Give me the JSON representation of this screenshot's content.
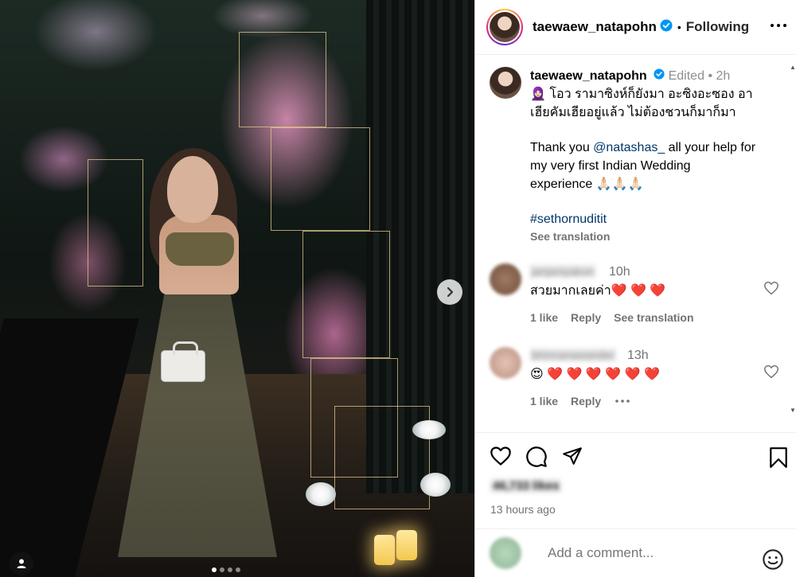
{
  "post": {
    "username": "taewaew_natapohn",
    "following_label": "Following",
    "separator": "•",
    "caption": {
      "edited_label": "Edited",
      "dot": "•",
      "time": "2h",
      "thai_line_1": "🧕🏻 โอว รามาซิงห์ก็ยังมา อะซิงอะซอง อา",
      "thai_line_2": "เฮียคัมเฮียอยู่แล้ว ไม่ต้องชวนก็มาก็มา",
      "english_1": "Thank you ",
      "mention": "@natashas_",
      "english_2": " all your help for",
      "english_3": "my very first Indian Wedding",
      "english_4": "experience 🙏🏻🙏🏻🙏🏻",
      "hashtag": "#sethornuditit",
      "see_translation": "See translation"
    }
  },
  "comments": [
    {
      "username": "janjaniyakon",
      "time": "10h",
      "text": "สวยมากเลยค่า❤️ ❤️ ❤️",
      "likes": "1 like",
      "reply": "Reply",
      "see_translation": "See translation",
      "avatar_color": "#8a6a56"
    },
    {
      "username": "bhinnanawander",
      "time": "13h",
      "text": "😍 ❤️ ❤️ ❤️ ❤️ ❤️ ❤️",
      "likes": "1 like",
      "reply": "Reply",
      "avatar_color": "#c9a296"
    }
  ],
  "actions": {
    "likes_label": "46,733 likes",
    "time_ago": "13 hours ago"
  },
  "add_comment": {
    "placeholder": "Add a comment..."
  },
  "colors": {
    "verified": "#0095f6",
    "heart_red": "#ed1c3c",
    "link": "#00376b"
  }
}
